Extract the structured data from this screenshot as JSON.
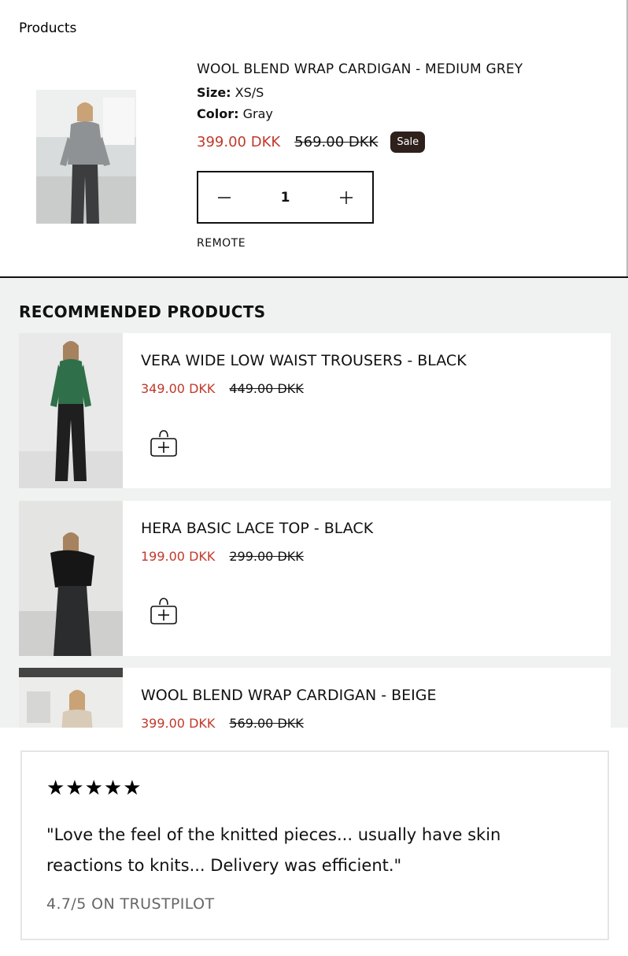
{
  "products_label": "Products",
  "cart_item": {
    "title": "WOOL BLEND WRAP CARDIGAN - MEDIUM GREY",
    "size_label": "Size:",
    "size_value": "XS/S",
    "color_label": "Color:",
    "color_value": "Gray",
    "sale_price": "399.00 DKK",
    "original_price": "569.00 DKK",
    "badge": "Sale",
    "quantity": "1",
    "remote_label": "REMOTE"
  },
  "recommended": {
    "heading": "RECOMMENDED PRODUCTS",
    "items": [
      {
        "name": "VERA WIDE LOW WAIST TROUSERS - BLACK",
        "price": "349.00 DKK",
        "original_price": "449.00 DKK",
        "icon": "add-to-bag-icon"
      },
      {
        "name": "HERA BASIC LACE TOP - BLACK",
        "price": "199.00 DKK",
        "original_price": "299.00 DKK",
        "icon": "add-to-bag-icon"
      },
      {
        "name": "WOOL BLEND WRAP CARDIGAN - BEIGE",
        "price": "399.00 DKK",
        "original_price": "569.00 DKK",
        "icon": "add-to-bag-icon"
      }
    ]
  },
  "review": {
    "stars": "★★★★★",
    "rating": 5,
    "quote": "\"Love the feel of the knitted pieces... usually have skin reactions to knits... Delivery was efficient.\"",
    "trustpilot": "4.7/5 ON TRUSTPILOT"
  },
  "colors": {
    "sale": "#c0392b",
    "badge_bg": "#2e201b",
    "section_bg": "#f0f2f1"
  }
}
